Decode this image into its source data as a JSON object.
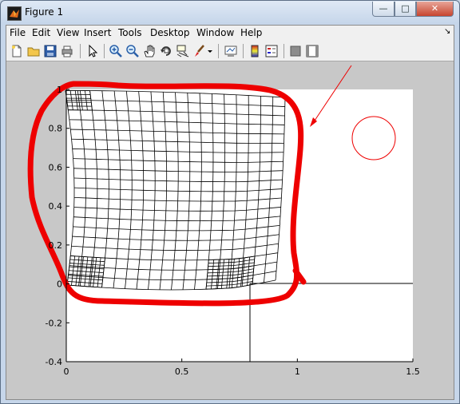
{
  "window": {
    "title": "Figure 1",
    "minimize_glyph": "—",
    "maximize_glyph": "□",
    "close_glyph": "✕"
  },
  "menu": {
    "items": [
      "File",
      "Edit",
      "View",
      "Insert",
      "Tools",
      "Desktop",
      "Window",
      "Help"
    ],
    "dock_arrow": "↘"
  },
  "toolbar": {
    "buttons": [
      "new-figure",
      "open-file",
      "save-figure",
      "print-figure",
      "edit-plot",
      "zoom-in",
      "zoom-out",
      "pan",
      "rotate-3d",
      "data-cursor",
      "brush",
      "brush-menu",
      "link-plot",
      "insert-colorbar",
      "insert-legend",
      "hide-plot-tools",
      "show-plot-tools"
    ]
  },
  "axes": {
    "xticks": [
      "0",
      "0.5",
      "1",
      "1.5"
    ],
    "yticks": [
      "-0.4",
      "-0.2",
      "0",
      "0.2",
      "0.4",
      "0.6",
      "0.8",
      "1"
    ],
    "xlim": [
      0,
      1.5
    ],
    "ylim": [
      -0.4,
      1.0
    ],
    "background": "#ffffff",
    "grid": false
  },
  "annotations": {
    "highlight_color": "#ff0000",
    "arrow_color": "#ff0000",
    "circle_color": "#ff0000"
  },
  "colors": {
    "mesh": "#000000",
    "figure_background": "#c8c8c8"
  }
}
